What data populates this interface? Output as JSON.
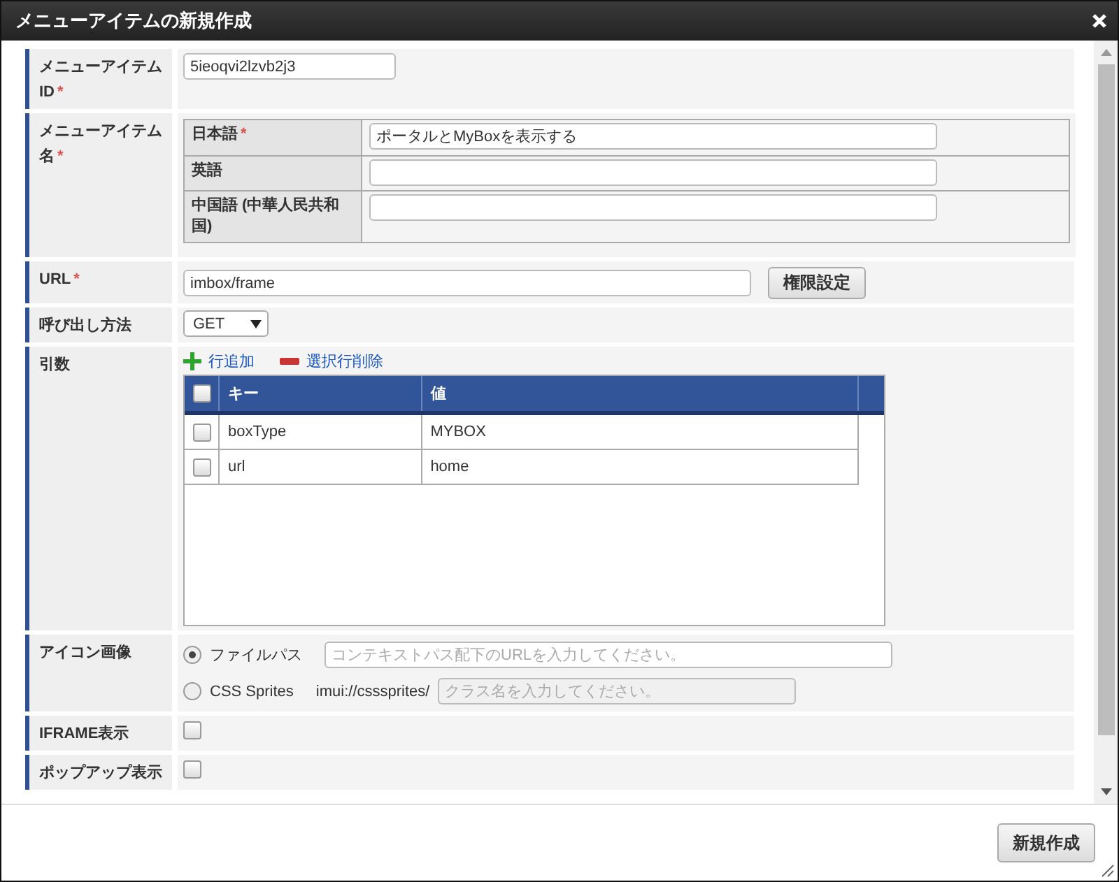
{
  "dialog": {
    "title": "メニューアイテムの新規作成"
  },
  "form": [
    {
      "kind": "text",
      "label": "メニューアイテムID",
      "required_mark": "*",
      "value": "5ieoqvi2lzvb2j3"
    },
    {
      "kind": "locales",
      "label": "メニューアイテム名",
      "required_mark": "*",
      "locales": [
        {
          "label": "日本語",
          "required_mark": "*",
          "value": "ポータルとMyBoxを表示する"
        },
        {
          "label": "英語"
        },
        {
          "label": "中国語 (中華人民共和国)"
        }
      ]
    },
    {
      "kind": "url",
      "label": "URL",
      "required_mark": "*",
      "value": "imbox/frame",
      "button": "権限設定"
    },
    {
      "kind": "select",
      "label": "呼び出し方法",
      "value": "GET"
    },
    {
      "kind": "params",
      "label": "引数",
      "add": "行追加",
      "remove": "選択行削除",
      "header_checked": false,
      "columns": [
        "キー",
        "値"
      ],
      "rows": [
        {
          "key": "boxType",
          "value": "MYBOX",
          "checked": false
        },
        {
          "key": "url",
          "value": "home",
          "checked": false
        }
      ]
    },
    {
      "kind": "icon",
      "label": "アイコン画像",
      "options": [
        {
          "label": "ファイルパス",
          "selected": true,
          "placeholder": "コンテキストパス配下のURLを入力してください。"
        },
        {
          "label": "CSS Sprites",
          "selected": false,
          "prefix": "imui://csssprites/",
          "placeholder": "クラス名を入力してください。"
        }
      ]
    },
    {
      "kind": "checkbox",
      "label": "IFRAME表示",
      "checked": false
    },
    {
      "kind": "checkbox",
      "label": "ポップアップ表示",
      "checked": false
    }
  ],
  "footer": {
    "button": "新規作成"
  }
}
